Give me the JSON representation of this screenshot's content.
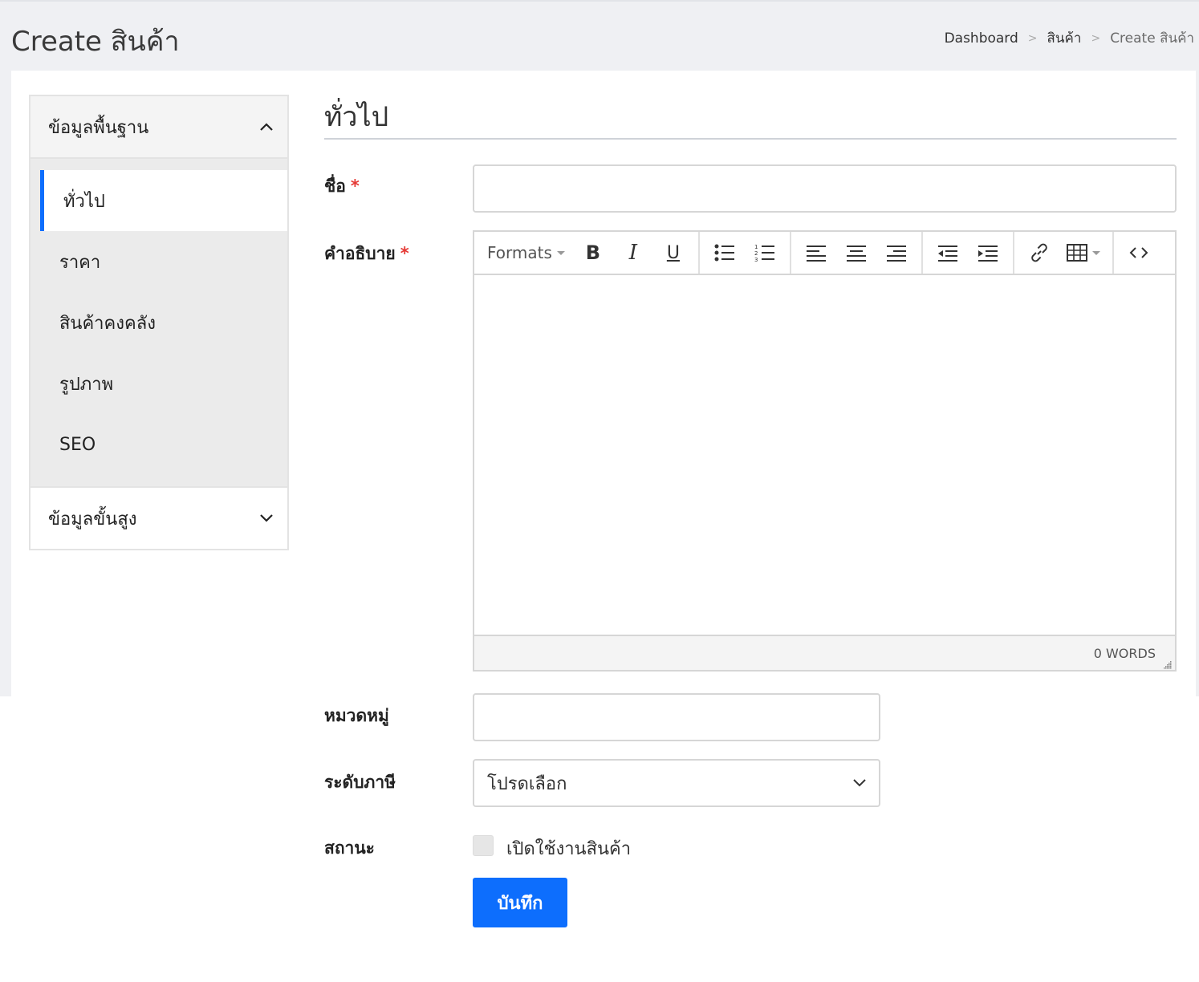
{
  "page": {
    "title": "Create สินค้า"
  },
  "breadcrumb": {
    "items": [
      "Dashboard",
      "สินค้า",
      "Create สินค้า"
    ],
    "separator": ">"
  },
  "sidebar": {
    "basic_header": "ข้อมูลพื้นฐาน",
    "items": [
      {
        "label": "ทั่วไป",
        "active": true
      },
      {
        "label": "ราคา"
      },
      {
        "label": "สินค้าคงคลัง"
      },
      {
        "label": "รูปภาพ"
      },
      {
        "label": "SEO"
      }
    ],
    "advanced_header": "ข้อมูลขั้นสูง"
  },
  "form": {
    "section_title": "ทั่วไป",
    "name_label": "ชื่อ",
    "name_value": "",
    "required_mark": "*",
    "description_label": "คำอธิบาย",
    "editor": {
      "formats_label": "Formats",
      "bold": "B",
      "italic": "I",
      "underline": "U",
      "word_count": "0 WORDS"
    },
    "category_label": "หมวดหมู่",
    "category_value": "",
    "tax_label": "ระดับภาษี",
    "tax_selected": "โปรดเลือก",
    "status_label": "สถานะ",
    "status_checkbox_label": "เปิดใช้งานสินค้า",
    "status_checked": false,
    "save_label": "บันทึก"
  },
  "colors": {
    "accent": "#0d6efd",
    "required": "#e53935",
    "background": "#eff0f3"
  }
}
